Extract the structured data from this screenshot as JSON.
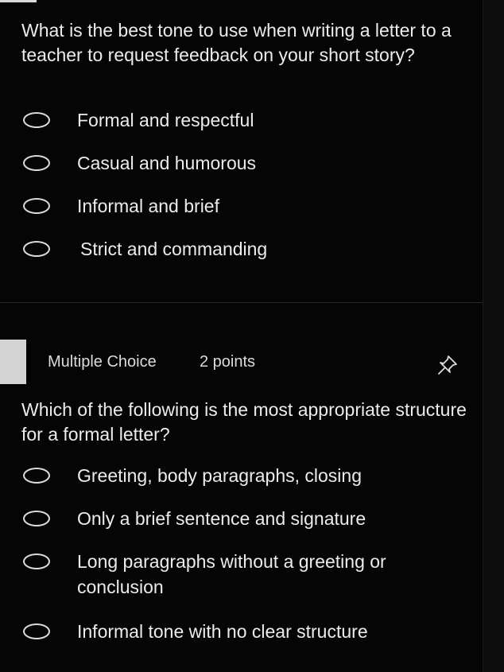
{
  "question1": {
    "text": "What is the best tone to use when writing a letter to a teacher to request feedback on your short story?",
    "options": [
      "Formal and respectful",
      "Casual and humorous",
      "Informal and brief",
      "Strict and commanding"
    ]
  },
  "question2": {
    "type_label": "Multiple Choice",
    "points_label": "2 points",
    "pin_icon": "pin-icon",
    "text": "Which of the following is the most appropriate structure for a formal letter?",
    "options": [
      "Greeting, body paragraphs, closing",
      "Only a brief sentence and signature",
      "Long paragraphs without a greeting or conclusion",
      "Informal tone with no clear structure"
    ]
  }
}
